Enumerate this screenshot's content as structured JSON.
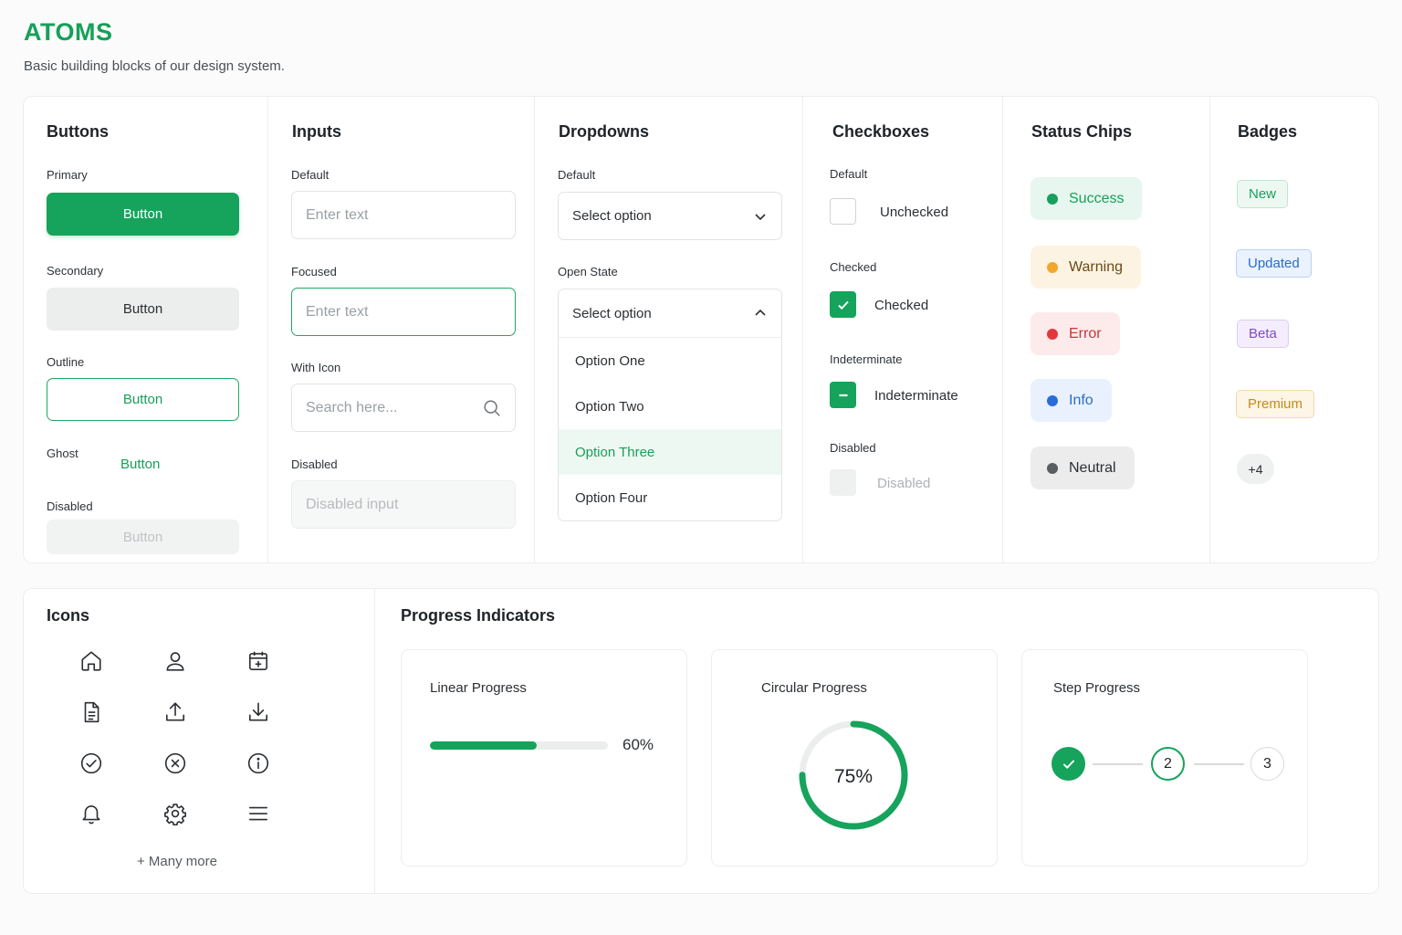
{
  "header": {
    "title": "ATOMS",
    "subtitle": "Basic building blocks of our design system."
  },
  "buttons": {
    "title": "Buttons",
    "primary_label": "Primary",
    "primary_text": "Button",
    "secondary_label": "Secondary",
    "secondary_text": "Button",
    "outline_label": "Outline",
    "outline_text": "Button",
    "ghost_label": "Ghost",
    "ghost_text": "Button",
    "disabled_label": "Disabled",
    "disabled_text": "Button"
  },
  "inputs": {
    "title": "Inputs",
    "default_label": "Default",
    "default_placeholder": "Enter text",
    "focused_label": "Focused",
    "focused_placeholder": "Enter text",
    "icon_label": "With Icon",
    "icon_placeholder": "Search here...",
    "disabled_label": "Disabled",
    "disabled_placeholder": "Disabled input"
  },
  "dropdowns": {
    "title": "Dropdowns",
    "default_label": "Default",
    "default_value": "Select option",
    "open_label": "Open State",
    "open_value": "Select option",
    "options": [
      "Option One",
      "Option Two",
      "Option Three",
      "Option Four"
    ],
    "selected_option": "Option Three"
  },
  "checkboxes": {
    "title": "Checkboxes",
    "default_label": "Default",
    "default_text": "Unchecked",
    "checked_label": "Checked",
    "checked_text": "Checked",
    "indeterminate_label": "Indeterminate",
    "indeterminate_text": "Indeterminate",
    "disabled_label": "Disabled",
    "disabled_text": "Disabled"
  },
  "chips": {
    "title": "Status Chips",
    "items": [
      "Success",
      "Warning",
      "Error",
      "Info",
      "Neutral"
    ]
  },
  "badges": {
    "title": "Badges",
    "items": [
      "New",
      "Updated",
      "Beta",
      "Premium"
    ],
    "count": "+4"
  },
  "icons": {
    "title": "Icons",
    "items": [
      "home-icon",
      "user-icon",
      "calendar-icon",
      "document-icon",
      "upload-icon",
      "download-icon",
      "check-circle-icon",
      "close-circle-icon",
      "info-icon",
      "bell-icon",
      "gear-icon",
      "menu-icon"
    ],
    "more": "+ Many more"
  },
  "progress": {
    "title": "Progress Indicators",
    "linear_title": "Linear Progress",
    "linear_value": 60,
    "linear_text": "60%",
    "circular_title": "Circular Progress",
    "circular_value": 75,
    "circular_text": "75%",
    "step_title": "Step Progress",
    "steps": [
      "2",
      "3"
    ],
    "current_step": 2
  },
  "colors": {
    "accent": "#16a35c",
    "success": "#17a05b",
    "warning": "#f2a72a",
    "error": "#e2383d",
    "info": "#2a6cd8",
    "neutral": "#5a5e62"
  }
}
